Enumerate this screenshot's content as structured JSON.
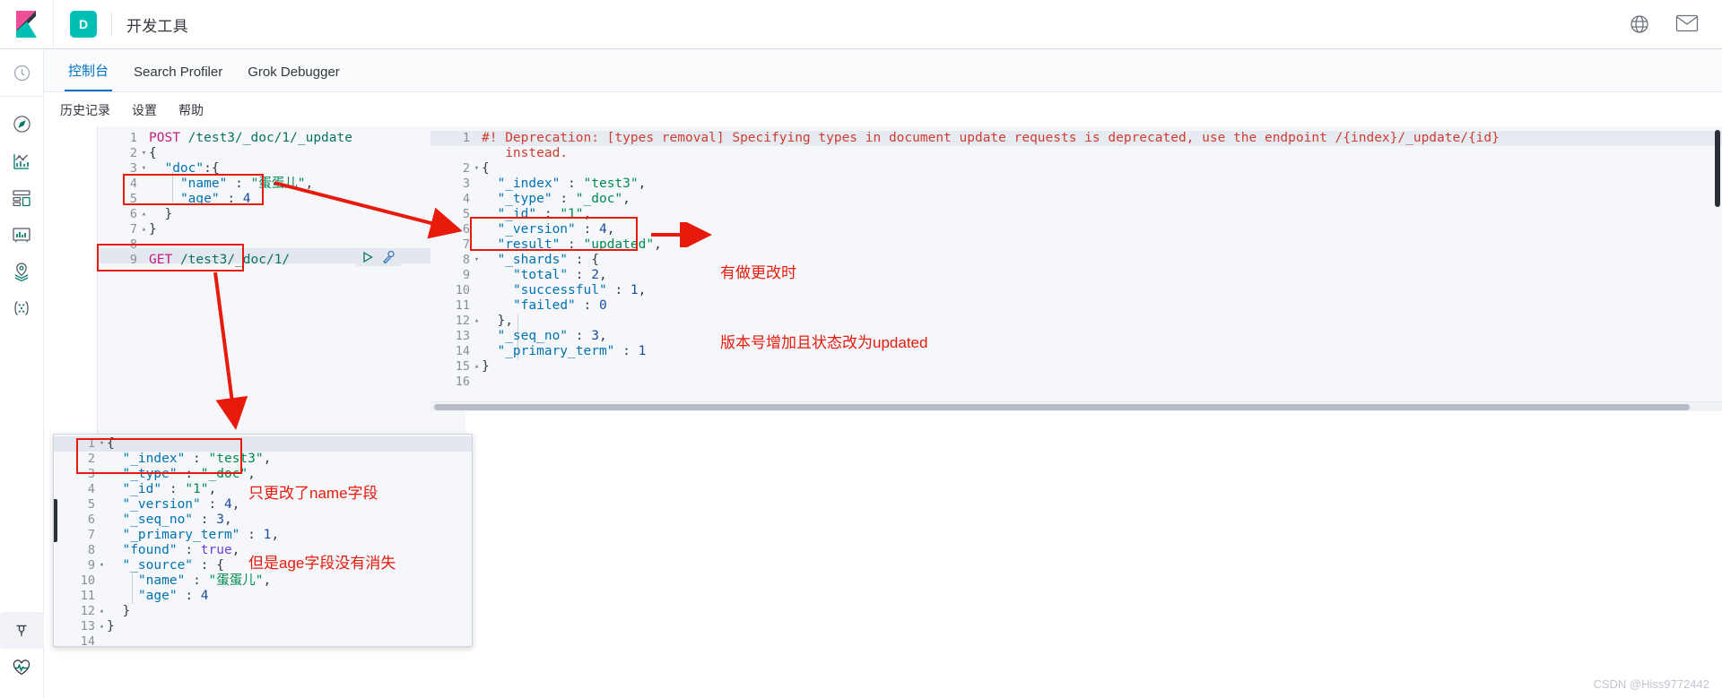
{
  "header": {
    "space_badge": "D",
    "app_title": "开发工具",
    "icons": [
      {
        "name": "help-icon",
        "glyph": "help"
      },
      {
        "name": "mail-icon",
        "glyph": "mail"
      }
    ]
  },
  "rail": {
    "items": [
      {
        "name": "recently-viewed-icon",
        "glyph": "clock"
      },
      {
        "name": "discover-icon",
        "glyph": "compass"
      },
      {
        "name": "visualize-icon",
        "glyph": "chart"
      },
      {
        "name": "dashboard-icon",
        "glyph": "dashboard"
      },
      {
        "name": "canvas-icon",
        "glyph": "canvas"
      },
      {
        "name": "maps-icon",
        "glyph": "map-pin"
      },
      {
        "name": "machine-learning-icon",
        "glyph": "ml"
      }
    ],
    "bottom_items": [
      {
        "name": "dev-tools-icon",
        "glyph": "wrench"
      },
      {
        "name": "monitoring-icon",
        "glyph": "heartbeat"
      }
    ]
  },
  "tabs": [
    {
      "label": "控制台",
      "active": true
    },
    {
      "label": "Search Profiler",
      "active": false
    },
    {
      "label": "Grok Debugger",
      "active": false
    }
  ],
  "console_menu": [
    "历史记录",
    "设置",
    "帮助"
  ],
  "request_editor": {
    "lines": [
      {
        "num": "1",
        "fold": "",
        "text": "POST /test3/_doc/1/_update"
      },
      {
        "num": "2",
        "fold": "▾",
        "text": "{"
      },
      {
        "num": "3",
        "fold": "▾",
        "text": "  \"doc\":{"
      },
      {
        "num": "4",
        "fold": "",
        "text": "    \"name\" : \"蛋蛋儿\","
      },
      {
        "num": "5",
        "fold": "",
        "text": "    \"age\" : 4"
      },
      {
        "num": "6",
        "fold": "▴",
        "text": "  }"
      },
      {
        "num": "7",
        "fold": "▴",
        "text": "}"
      },
      {
        "num": "8",
        "fold": "",
        "text": ""
      },
      {
        "num": "9",
        "fold": "",
        "text": "GET /test3/_doc/1/"
      }
    ]
  },
  "response_editor": {
    "lines": [
      {
        "num": "1",
        "fold": "",
        "text": "#! Deprecation: [types removal] Specifying types in document update requests is deprecated, use the endpoint /{index}/_update/{id}"
      },
      {
        "num": "",
        "fold": "",
        "text": "   instead."
      },
      {
        "num": "2",
        "fold": "▾",
        "text": "{"
      },
      {
        "num": "3",
        "fold": "",
        "text": "  \"_index\" : \"test3\","
      },
      {
        "num": "4",
        "fold": "",
        "text": "  \"_type\" : \"_doc\","
      },
      {
        "num": "5",
        "fold": "",
        "text": "  \"_id\" : \"1\","
      },
      {
        "num": "6",
        "fold": "",
        "text": "  \"_version\" : 4,"
      },
      {
        "num": "7",
        "fold": "",
        "text": "  \"result\" : \"updated\","
      },
      {
        "num": "8",
        "fold": "▾",
        "text": "  \"_shards\" : {"
      },
      {
        "num": "9",
        "fold": "",
        "text": "    \"total\" : 2,"
      },
      {
        "num": "10",
        "fold": "",
        "text": "    \"successful\" : 1,"
      },
      {
        "num": "11",
        "fold": "",
        "text": "    \"failed\" : 0"
      },
      {
        "num": "12",
        "fold": "▴",
        "text": "  },"
      },
      {
        "num": "13",
        "fold": "",
        "text": "  \"_seq_no\" : 3,"
      },
      {
        "num": "14",
        "fold": "",
        "text": "  \"_primary_term\" : 1"
      },
      {
        "num": "15",
        "fold": "▴",
        "text": "}"
      },
      {
        "num": "16",
        "fold": "",
        "text": ""
      }
    ]
  },
  "popup_response": {
    "lines": [
      {
        "num": "1",
        "fold": "▾",
        "text": "{"
      },
      {
        "num": "2",
        "fold": "",
        "text": "  \"_index\" : \"test3\","
      },
      {
        "num": "3",
        "fold": "",
        "text": "  \"_type\" : \"_doc\","
      },
      {
        "num": "4",
        "fold": "",
        "text": "  \"_id\" : \"1\","
      },
      {
        "num": "5",
        "fold": "",
        "text": "  \"_version\" : 4,"
      },
      {
        "num": "6",
        "fold": "",
        "text": "  \"_seq_no\" : 3,"
      },
      {
        "num": "7",
        "fold": "",
        "text": "  \"_primary_term\" : 1,"
      },
      {
        "num": "8",
        "fold": "",
        "text": "  \"found\" : true,"
      },
      {
        "num": "9",
        "fold": "▾",
        "text": "  \"_source\" : {"
      },
      {
        "num": "10",
        "fold": "",
        "text": "    \"name\" : \"蛋蛋儿\","
      },
      {
        "num": "11",
        "fold": "",
        "text": "    \"age\" : 4"
      },
      {
        "num": "12",
        "fold": "▴",
        "text": "  }"
      },
      {
        "num": "13",
        "fold": "▴",
        "text": "}"
      },
      {
        "num": "14",
        "fold": "",
        "text": ""
      }
    ]
  },
  "annotations": {
    "right_note_line1": "有做更改时",
    "right_note_line2": "版本号增加且状态改为updated",
    "bottom_note_line1": "只更改了name字段",
    "bottom_note_line2": "但是age字段没有消失"
  },
  "watermark": "CSDN @Hiss9772442",
  "colors": {
    "accent": "#0071c2",
    "teal": "#00bfb3",
    "annotation_red": "#e81a0c",
    "pink": "#f04e98"
  }
}
